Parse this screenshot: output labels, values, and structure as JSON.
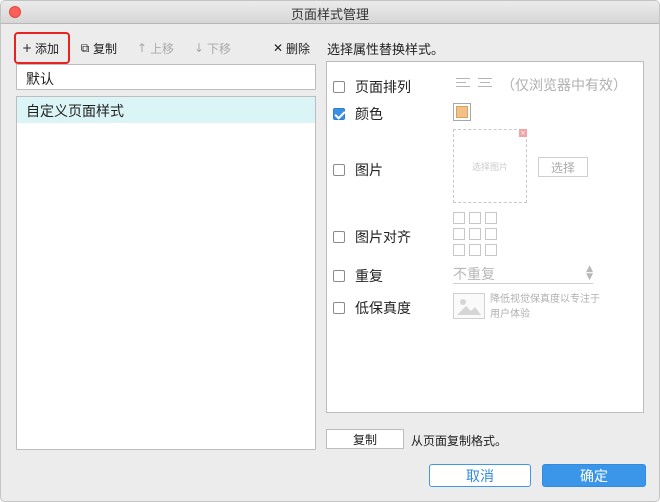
{
  "window": {
    "title": "页面样式管理"
  },
  "toolbar": {
    "add_label": "添加",
    "copy_label": "复制",
    "up_label": "上移",
    "down_label": "下移",
    "delete_label": "删除"
  },
  "left": {
    "name_value": "默认",
    "styles": [
      {
        "label": "自定义页面样式",
        "selected": true
      }
    ]
  },
  "right": {
    "heading": "选择属性替换样式。",
    "page_align_label": "页面排列",
    "page_align_hint": "（仅浏览器中有效）",
    "color_label": "颜色",
    "color_value": "#f3c085",
    "image_label": "图片",
    "image_placeholder": "选择图片",
    "choose_label": "选择",
    "image_align_label": "图片对齐",
    "repeat_label": "重复",
    "repeat_value": "不重复",
    "lowfi_label": "低保真度",
    "lowfi_hint": "降低视觉保真度以专注于用户体验"
  },
  "bottom": {
    "copy_label": "复制",
    "copy_hint": "从页面复制格式。",
    "cancel_label": "取消",
    "ok_label": "确定"
  },
  "colors": {
    "accent": "#3b95e8",
    "selection": "#dbf4f6",
    "highlight": "#e8231f"
  }
}
